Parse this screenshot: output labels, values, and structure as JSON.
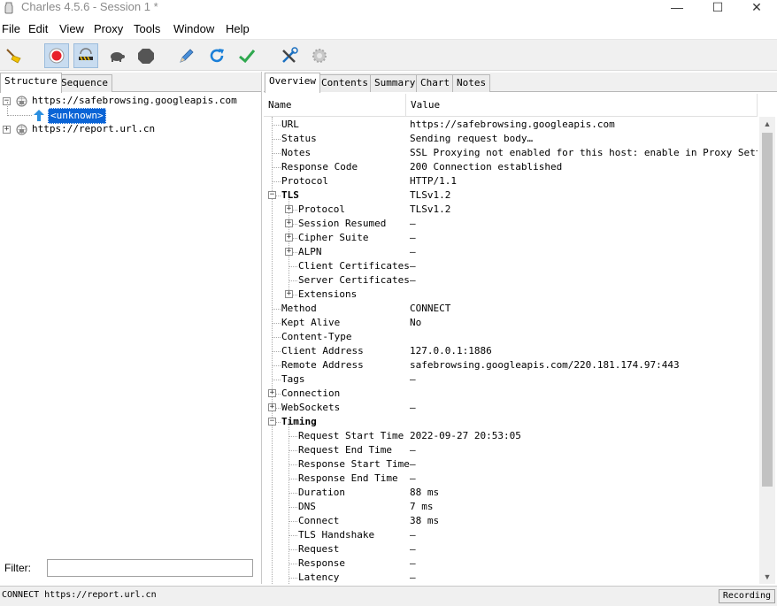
{
  "window": {
    "title": "Charles 4.5.6 - Session 1 *",
    "minimize": "—",
    "maximize": "☐",
    "close": "✕"
  },
  "menu": [
    "File",
    "Edit",
    "View",
    "Proxy",
    "Tools",
    "Window",
    "Help"
  ],
  "toolbar": {
    "icons": [
      "broom-icon",
      "record-icon",
      "throttle-icon",
      "turtle-icon",
      "stop-icon",
      "pen-icon",
      "refresh-icon",
      "check-icon",
      "tools-icon",
      "gear-icon"
    ]
  },
  "left": {
    "tabs": [
      "Structure",
      "Sequence"
    ],
    "tree": [
      {
        "label": "https://safebrowsing.googleapis.com",
        "expanded": true
      },
      {
        "label": "<unknown>",
        "selected": true
      },
      {
        "label": "https://report.url.cn",
        "expanded": false
      }
    ],
    "filter_label": "Filter:",
    "filter_value": ""
  },
  "right": {
    "tabs": [
      "Overview",
      "Contents",
      "Summary",
      "Chart",
      "Notes"
    ],
    "columns": [
      "Name",
      "Value"
    ],
    "rows": [
      {
        "name": "URL",
        "value": "https://safebrowsing.googleapis.com",
        "level": 0
      },
      {
        "name": "Status",
        "value": "Sending request body…",
        "level": 0
      },
      {
        "name": "Notes",
        "value": "SSL Proxying not enabled for this host: enable in Proxy Settin...",
        "level": 0
      },
      {
        "name": "Response Code",
        "value": "200 Connection established",
        "level": 0
      },
      {
        "name": "Protocol",
        "value": "HTTP/1.1",
        "level": 0
      },
      {
        "name": "TLS",
        "value": "TLSv1.2",
        "level": 0,
        "bold": true,
        "expander": "minus"
      },
      {
        "name": "Protocol",
        "value": "TLSv1.2",
        "level": 1,
        "expander": "plus"
      },
      {
        "name": "Session Resumed",
        "value": "–",
        "level": 1,
        "expander": "plus"
      },
      {
        "name": "Cipher Suite",
        "value": "–",
        "level": 1,
        "expander": "plus"
      },
      {
        "name": "ALPN",
        "value": "–",
        "level": 1,
        "expander": "plus"
      },
      {
        "name": "Client Certificates",
        "value": "–",
        "level": 1
      },
      {
        "name": "Server Certificates",
        "value": "–",
        "level": 1
      },
      {
        "name": "Extensions",
        "value": "",
        "level": 1,
        "expander": "plus"
      },
      {
        "name": "Method",
        "value": "CONNECT",
        "level": 0
      },
      {
        "name": "Kept Alive",
        "value": "No",
        "level": 0
      },
      {
        "name": "Content-Type",
        "value": "",
        "level": 0
      },
      {
        "name": "Client Address",
        "value": "127.0.0.1:1886",
        "level": 0
      },
      {
        "name": "Remote Address",
        "value": "safebrowsing.googleapis.com/220.181.174.97:443",
        "level": 0
      },
      {
        "name": "Tags",
        "value": "–",
        "level": 0
      },
      {
        "name": "Connection",
        "value": "",
        "level": 0,
        "expander": "plus"
      },
      {
        "name": "WebSockets",
        "value": "–",
        "level": 0,
        "expander": "plus"
      },
      {
        "name": "Timing",
        "value": "",
        "level": 0,
        "bold": true,
        "expander": "minus"
      },
      {
        "name": "Request Start Time",
        "value": "2022-09-27 20:53:05",
        "level": 1
      },
      {
        "name": "Request End Time",
        "value": "–",
        "level": 1
      },
      {
        "name": "Response Start Time",
        "value": "–",
        "level": 1
      },
      {
        "name": "Response End Time",
        "value": "–",
        "level": 1
      },
      {
        "name": "Duration",
        "value": "88 ms",
        "level": 1
      },
      {
        "name": "DNS",
        "value": "7 ms",
        "level": 1
      },
      {
        "name": "Connect",
        "value": "38 ms",
        "level": 1
      },
      {
        "name": "TLS Handshake",
        "value": "–",
        "level": 1
      },
      {
        "name": "Request",
        "value": "–",
        "level": 1
      },
      {
        "name": "Response",
        "value": "–",
        "level": 1
      },
      {
        "name": "Latency",
        "value": "–",
        "level": 1
      }
    ]
  },
  "status": {
    "text": "CONNECT https://report.url.cn",
    "recording": "Recording"
  },
  "colors": {
    "selection": "#0a64d6",
    "toolbar_bg": "#f0f0f0",
    "pressed": "#c8dcf0"
  }
}
